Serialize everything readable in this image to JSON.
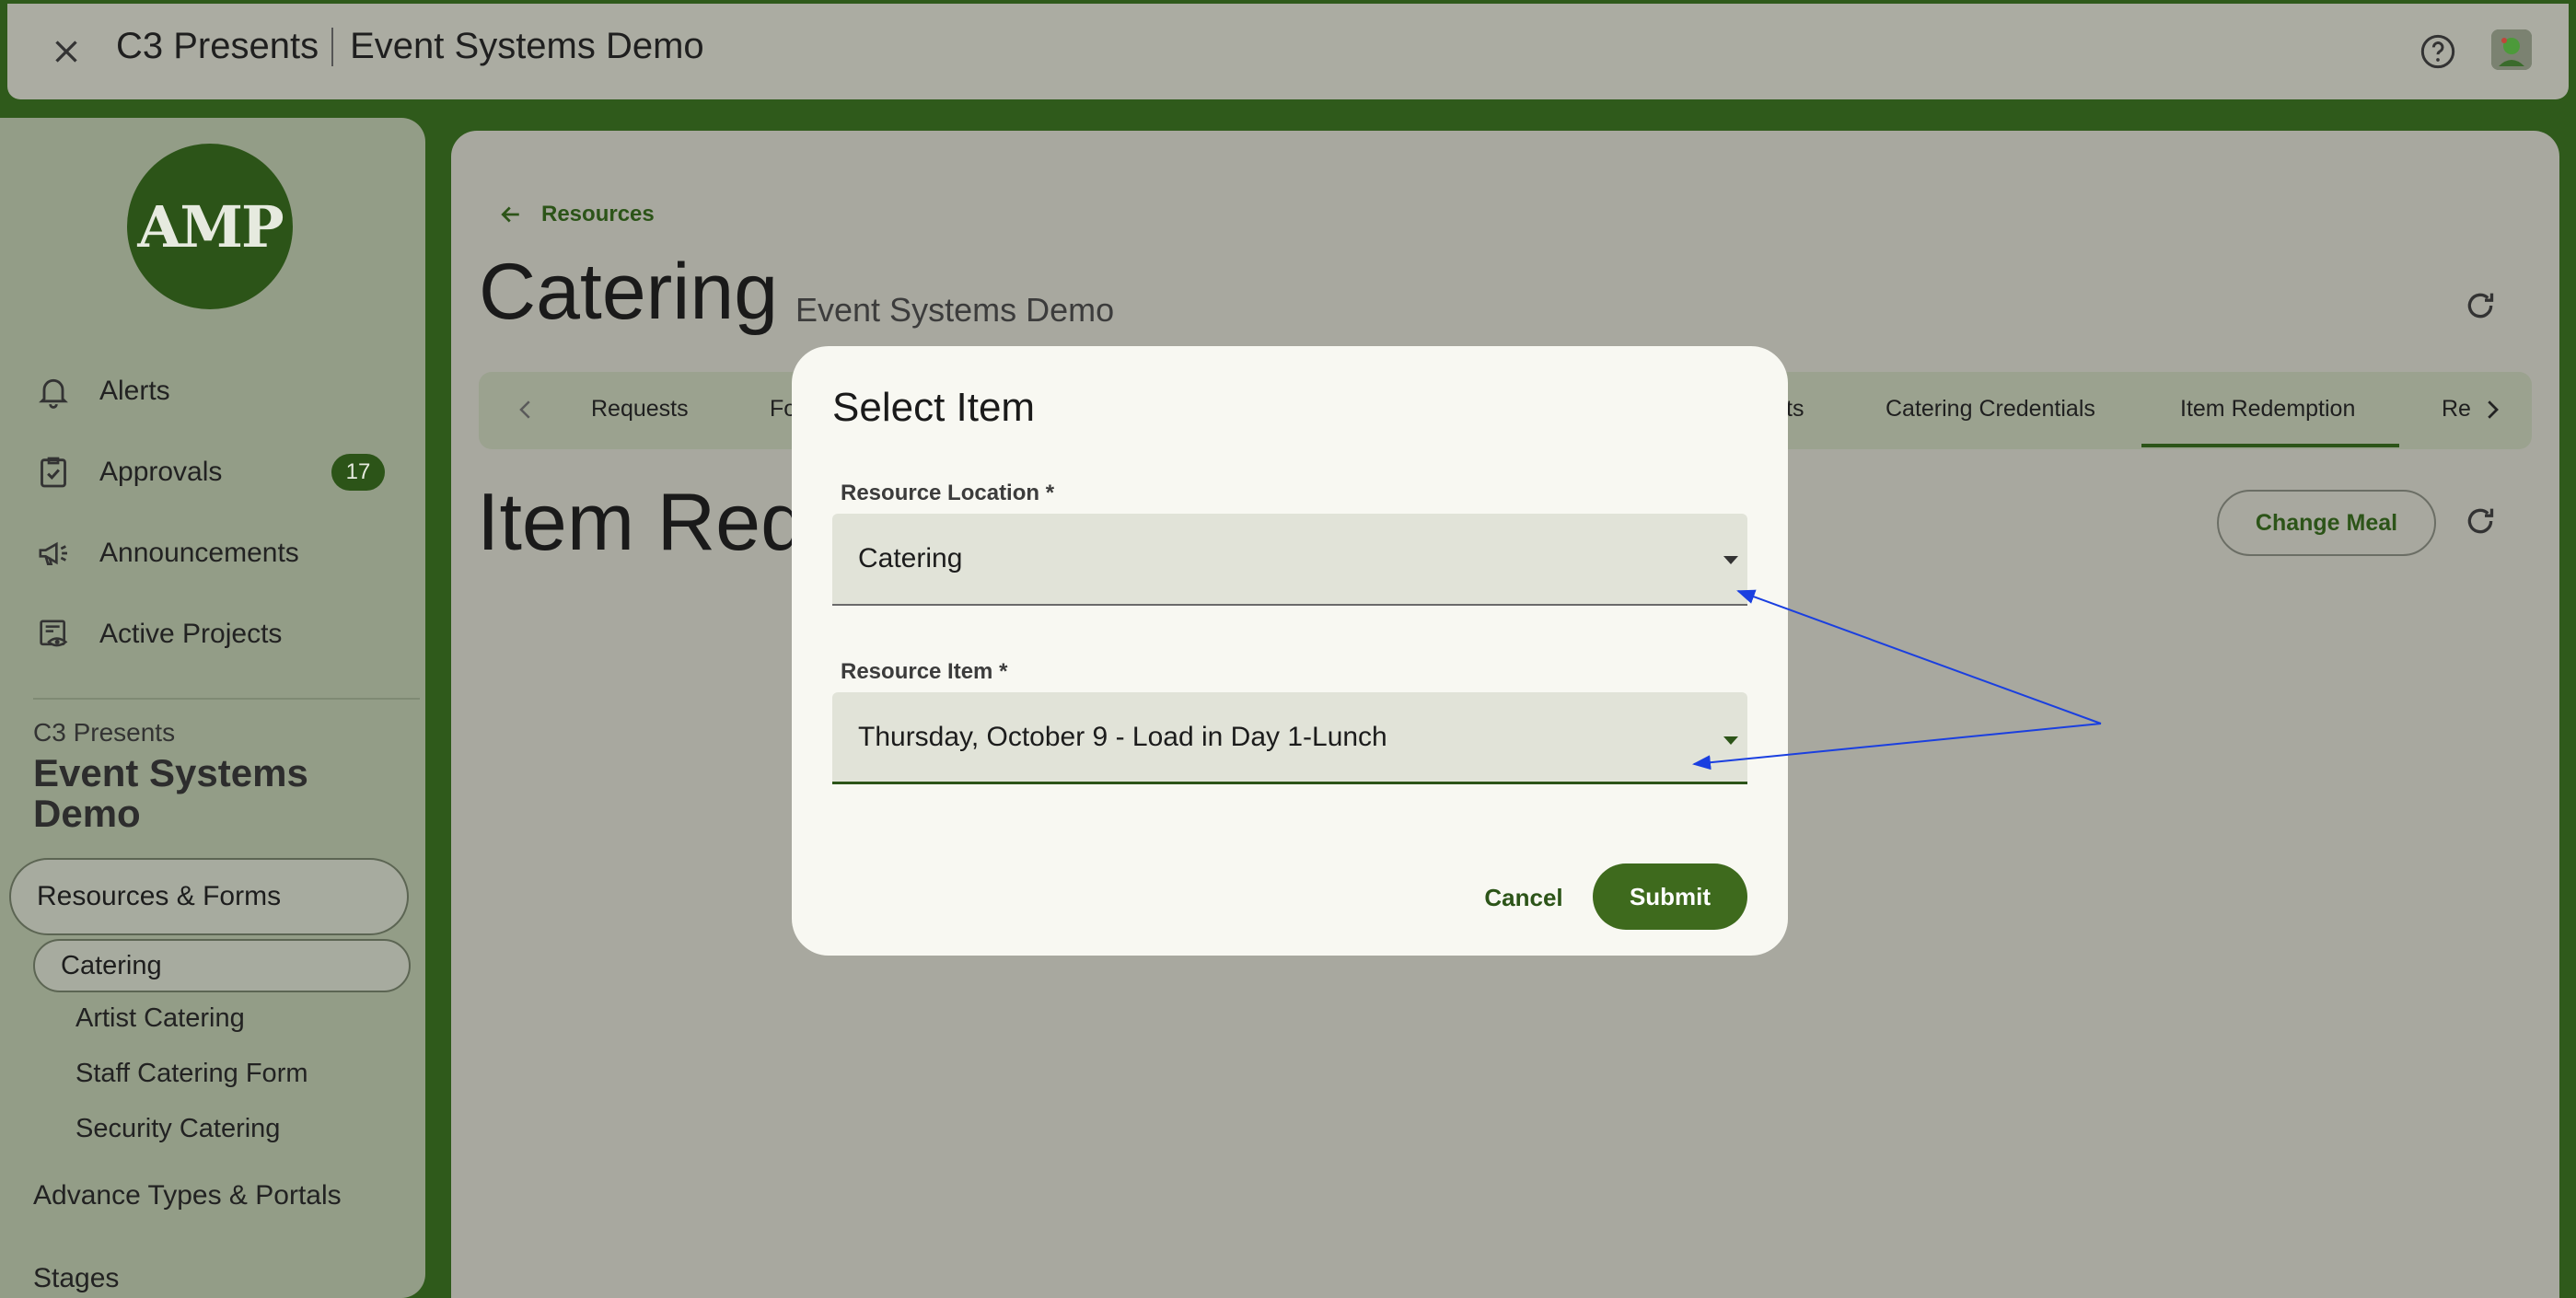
{
  "header": {
    "org": "C3 Presents",
    "project": "Event Systems Demo",
    "close_icon": "close-icon",
    "help_icon": "help-circle-icon",
    "avatar_icon": "user-avatar"
  },
  "sidebar": {
    "logo_text": "AMP",
    "nav": [
      {
        "label": "Alerts",
        "icon": "bell-icon"
      },
      {
        "label": "Approvals",
        "icon": "clipboard-check-icon",
        "badge": "17"
      },
      {
        "label": "Announcements",
        "icon": "megaphone-icon"
      },
      {
        "label": "Active Projects",
        "icon": "project-eye-icon"
      }
    ],
    "org_label": "C3 Presents",
    "project_label": "Event Systems Demo",
    "section": "Resources & Forms",
    "selected_item": "Catering",
    "sub_items": [
      "Artist Catering",
      "Staff Catering Form",
      "Security Catering"
    ],
    "lower_items": [
      "Advance Types & Portals",
      "Stages"
    ]
  },
  "main": {
    "back_label": "Resources",
    "title": "Catering",
    "subtitle": "Event Systems Demo",
    "tabs": [
      "Requests",
      "Fo",
      "ts",
      "Catering Credentials",
      "Item Redemption",
      "Re"
    ],
    "active_tab": "Item Redemption",
    "section_title": "Item Red",
    "change_meal_label": "Change Meal"
  },
  "dialog": {
    "title": "Select Item",
    "location_label": "Resource Location *",
    "location_value": "Catering",
    "item_label": "Resource Item *",
    "item_value": "Thursday, October 9 - Load in Day 1-Lunch",
    "cancel_label": "Cancel",
    "submit_label": "Submit"
  },
  "colors": {
    "brand_green": "#2c5418",
    "submit_green": "#3e6a1d",
    "annotation_blue": "#1a3fe0"
  }
}
